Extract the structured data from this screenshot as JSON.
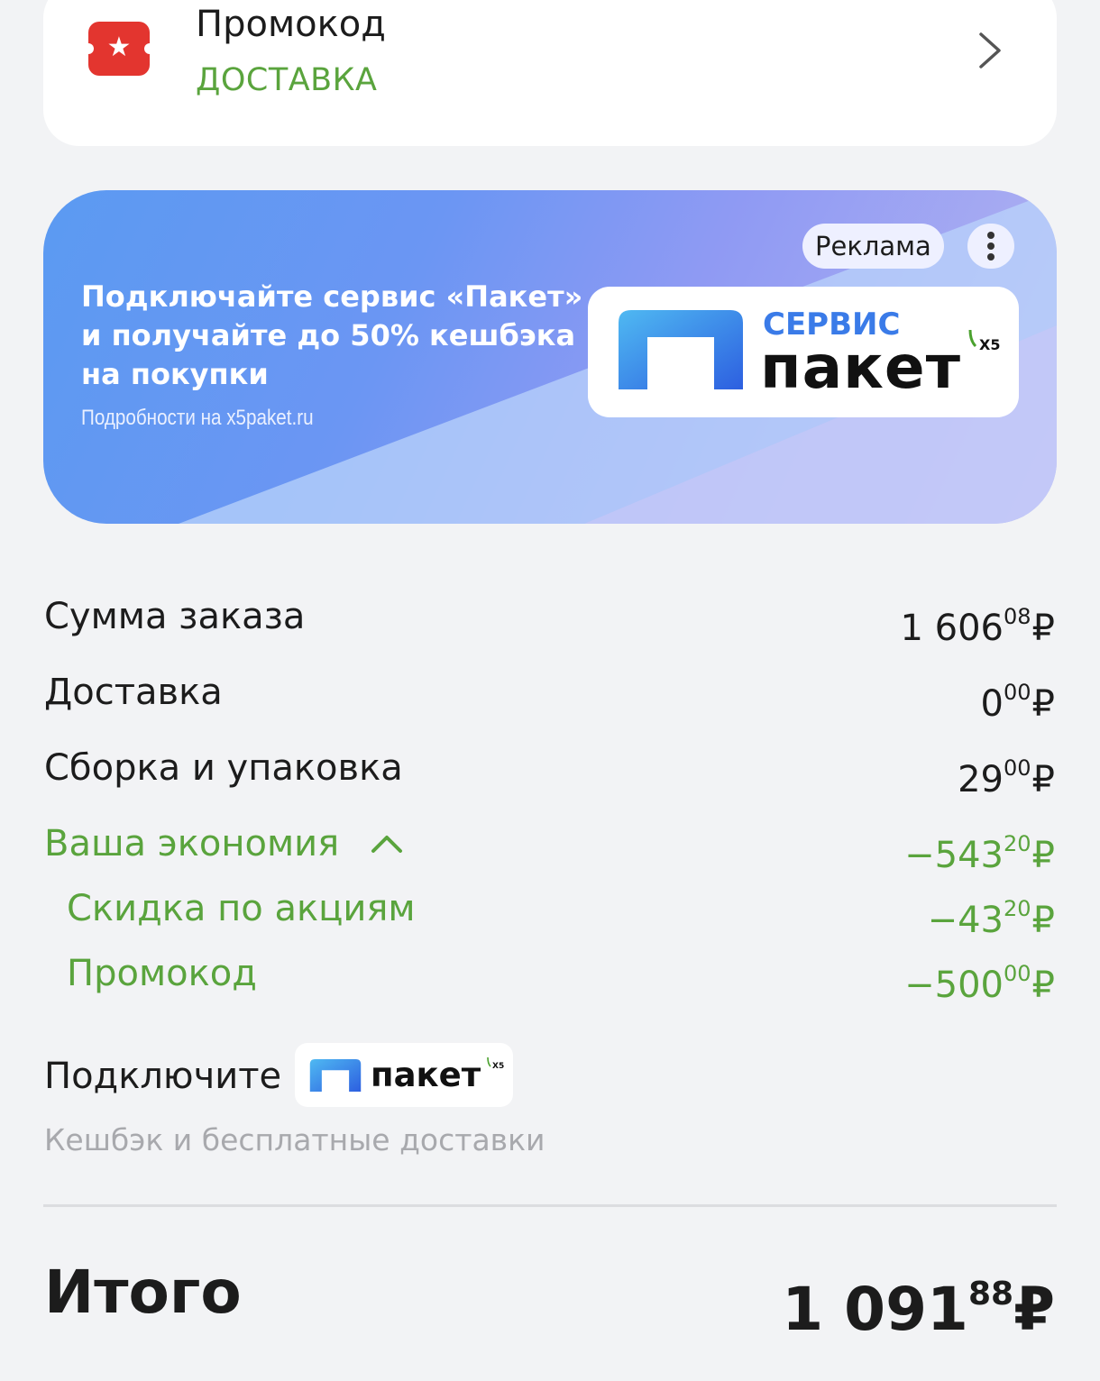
{
  "promo": {
    "title": "Промокод",
    "subtitle": "ДОСТАВКА",
    "icon": "coupon-star-icon"
  },
  "ad": {
    "text": "Подключайте сервис «Пакет» и получайте до 50% кешбэка на покупки",
    "link": "Подробности на x5paket.ru",
    "badge": "Реклама",
    "logo_top": "СЕРВИС",
    "logo_main": "пакет",
    "logo_brand": "X5"
  },
  "summary": {
    "order_sum": {
      "label": "Сумма заказа",
      "main": "1 606",
      "cents": "08",
      "currency": "₽"
    },
    "delivery": {
      "label": "Доставка",
      "main": "0",
      "cents": "00",
      "currency": "₽"
    },
    "packing": {
      "label": "Сборка и упаковка",
      "main": "29",
      "cents": "00",
      "currency": "₽"
    },
    "savings": {
      "label": "Ваша экономия",
      "main": "−543",
      "cents": "20",
      "currency": "₽"
    },
    "discount": {
      "label": "Скидка по акциям",
      "main": "−43",
      "cents": "20",
      "currency": "₽"
    },
    "promocode": {
      "label": "Промокод",
      "main": "−500",
      "cents": "00",
      "currency": "₽"
    }
  },
  "connect": {
    "label": "Подключите",
    "chip_text": "пакет",
    "chip_brand": "X5",
    "hint": "Кешбэк и бесплатные доставки"
  },
  "total": {
    "label": "Итого",
    "main": "1 091",
    "cents": "88",
    "currency": "₽"
  },
  "colors": {
    "accent_green": "#5aa43d",
    "promo_red": "#e3352f",
    "brand_blue": "#3a7be8"
  }
}
